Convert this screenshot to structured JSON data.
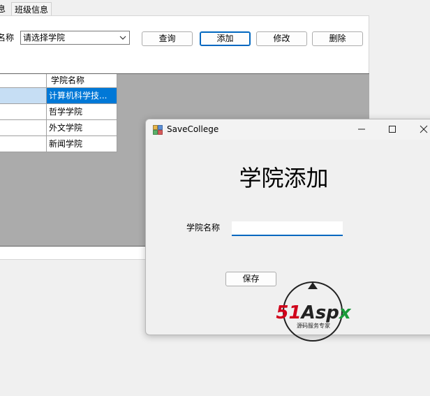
{
  "main_window": {
    "tabs": [
      {
        "label": "息"
      },
      {
        "label": "班级信息"
      }
    ],
    "filter": {
      "label": "名称",
      "select_value": "请选择学院"
    },
    "buttons": {
      "query": "查询",
      "add": "添加",
      "edit": "修改",
      "delete": "删除"
    },
    "grid": {
      "column_header": "学院名称",
      "rows": [
        {
          "name": "计算机科学技..."
        },
        {
          "name": "哲学学院"
        },
        {
          "name": "外文学院"
        },
        {
          "name": "新闻学院"
        }
      ]
    }
  },
  "dialog": {
    "title": "SaveCollege",
    "heading": "学院添加",
    "field_label": "学院名称",
    "input_value": "",
    "save_label": "保存"
  },
  "watermark": {
    "brand": "51Aspx",
    "tagline": "源码服务专家"
  },
  "colors": {
    "selection": "#0078d7",
    "grid_background": "#ababab",
    "accent": "#0067c0",
    "watermark_red": "#d0021b",
    "watermark_green": "#1a9a3a"
  }
}
